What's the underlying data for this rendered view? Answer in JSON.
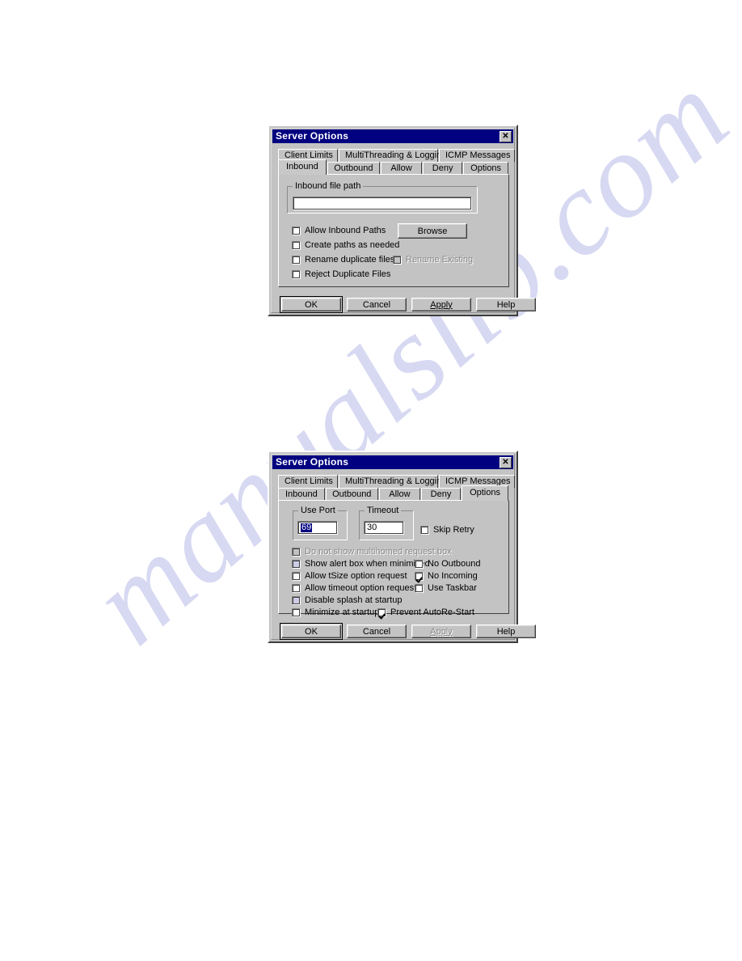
{
  "page": {
    "watermark_text": "manualslib.com",
    "background_color": "#ffffff"
  },
  "colors": {
    "titlebar": "#000080",
    "dialog_face": "#c3c3c3",
    "selection": "#000080",
    "disabled_text": "#8a8a8a"
  },
  "dialog_inbound": {
    "title": "Server Options",
    "close_label": "✕",
    "tabs_row1": [
      {
        "label": "Client Limits",
        "selected": false
      },
      {
        "label": "MultiThreading & Logging",
        "selected": false
      },
      {
        "label": "ICMP Messages",
        "selected": false
      }
    ],
    "tabs_row2": [
      {
        "label": "Inbound",
        "selected": true
      },
      {
        "label": "Outbound",
        "selected": false
      },
      {
        "label": "Allow",
        "selected": false
      },
      {
        "label": "Deny",
        "selected": false
      },
      {
        "label": "Options",
        "selected": false
      }
    ],
    "group_file_path": {
      "title": "Inbound file path",
      "value": "",
      "placeholder": ""
    },
    "browse_label": "Browse",
    "checkboxes": [
      {
        "label": "Allow Inbound Paths",
        "checked": false,
        "disabled": false
      },
      {
        "label": "Create paths as needed",
        "checked": false,
        "disabled": false
      },
      {
        "label": "Rename duplicate files",
        "checked": false,
        "disabled": false
      },
      {
        "label": "Rename Existing",
        "checked": false,
        "disabled": true
      },
      {
        "label": "Reject Duplicate Files",
        "checked": false,
        "disabled": false
      }
    ],
    "buttons": [
      {
        "label": "OK",
        "default": true,
        "disabled": false
      },
      {
        "label": "Cancel",
        "default": false,
        "disabled": false
      },
      {
        "label": "Apply",
        "default": false,
        "disabled": false,
        "accel": "A"
      },
      {
        "label": "Help",
        "default": false,
        "disabled": false
      }
    ]
  },
  "dialog_options": {
    "title": "Server Options",
    "close_label": "✕",
    "tabs_row1": [
      {
        "label": "Client Limits",
        "selected": false
      },
      {
        "label": "MultiThreading & Logging",
        "selected": false
      },
      {
        "label": "ICMP Messages",
        "selected": false
      }
    ],
    "tabs_row2": [
      {
        "label": "Inbound",
        "selected": false
      },
      {
        "label": "Outbound",
        "selected": false
      },
      {
        "label": "Allow",
        "selected": false
      },
      {
        "label": "Deny",
        "selected": false
      },
      {
        "label": "Options",
        "selected": true
      }
    ],
    "group_use_port": {
      "title": "Use Port",
      "value": "69",
      "selected": true
    },
    "group_timeout": {
      "title": "Timeout",
      "value": "30",
      "selected": false
    },
    "skip_retry": {
      "label": "Skip Retry",
      "checked": false,
      "disabled": false
    },
    "checkboxes_left": [
      {
        "label": "Do not show multihomed request box",
        "checked": false,
        "disabled": true
      },
      {
        "label": "Show alert box when minimised",
        "checked": false,
        "disabled": false
      },
      {
        "label": "Allow tSize option request",
        "checked": false,
        "disabled": false
      },
      {
        "label": "Allow timeout option request",
        "checked": false,
        "disabled": false
      },
      {
        "label": "Disable splash at startup",
        "checked": false,
        "disabled": false
      },
      {
        "label": "Minimize at startup",
        "checked": false,
        "disabled": false
      }
    ],
    "checkboxes_right": [
      {
        "label": "No Outbound",
        "checked": false,
        "disabled": false
      },
      {
        "label": "No Incoming",
        "checked": true,
        "disabled": false
      },
      {
        "label": "Use Taskbar",
        "checked": false,
        "disabled": false
      }
    ],
    "prevent_autorestart": {
      "label": "Prevent AutoRe-Start",
      "checked": true,
      "disabled": false
    },
    "buttons": [
      {
        "label": "OK",
        "default": true,
        "disabled": false
      },
      {
        "label": "Cancel",
        "default": false,
        "disabled": false
      },
      {
        "label": "Apply",
        "default": false,
        "disabled": true,
        "accel": "A"
      },
      {
        "label": "Help",
        "default": false,
        "disabled": false
      }
    ]
  }
}
